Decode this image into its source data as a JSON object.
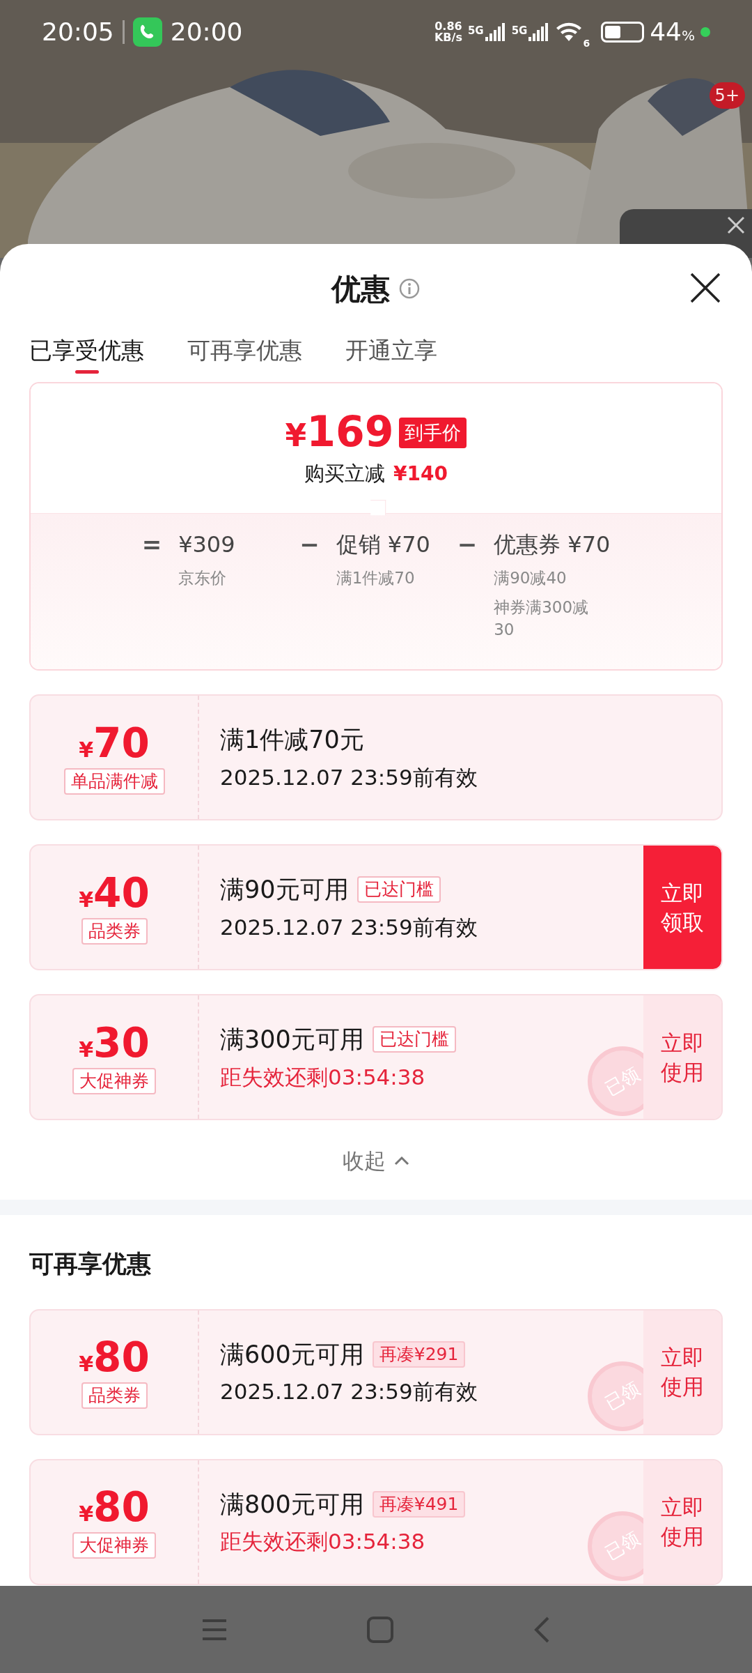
{
  "status_bar": {
    "time": "20:05",
    "call_time": "20:00",
    "speed": "0.86\nKB/s",
    "networks": [
      "5G",
      "5G"
    ],
    "wifi_label": "6",
    "battery": "44",
    "battery_unit": "%"
  },
  "background": {
    "kind": "picture",
    "badge": "5+"
  },
  "sheet": {
    "title": "优惠",
    "tabs": [
      {
        "label": "已享受优惠",
        "selected": true
      },
      {
        "label": "可再享优惠",
        "selected": false
      },
      {
        "label": "开通立享",
        "selected": false
      }
    ],
    "summary": {
      "price_symbol": "¥",
      "price": "169",
      "price_badge": "到手价",
      "saving_label": "购买立减",
      "saving": "¥140",
      "formula": [
        {
          "kind": "op",
          "text": "="
        },
        {
          "kind": "term",
          "text": "¥309",
          "notes": [
            "京东价"
          ]
        },
        {
          "kind": "op",
          "text": "−"
        },
        {
          "kind": "term",
          "text": "促销 ¥70",
          "notes": [
            "满1件减70"
          ]
        },
        {
          "kind": "op",
          "text": "−"
        },
        {
          "kind": "term",
          "text": "优惠券 ¥70",
          "notes": [
            "满90减40",
            "神券满300减30"
          ]
        }
      ]
    },
    "coupons": [
      {
        "symbol": "¥",
        "amount": "70",
        "type": "单品满件减",
        "title": "满1件减70元",
        "line": {
          "kind": "date",
          "text": "2025.12.07 23:59前有效"
        }
      },
      {
        "symbol": "¥",
        "amount": "40",
        "type": "品类券",
        "title": "满90元可用",
        "tag": {
          "kind": "outline",
          "text": "已达门槛"
        },
        "line": {
          "kind": "date",
          "text": "2025.12.07 23:59前有效"
        },
        "button": {
          "kind": "solid",
          "lines": [
            "立即",
            "领取"
          ]
        }
      },
      {
        "symbol": "¥",
        "amount": "30",
        "type": "大促神券",
        "title": "满300元可用",
        "tag": {
          "kind": "outline",
          "text": "已达门槛"
        },
        "line": {
          "kind": "countdown",
          "text": "距失效还剩03:54:38"
        },
        "button": {
          "kind": "light",
          "lines": [
            "立即",
            "使用"
          ]
        },
        "stamp": "已领"
      }
    ],
    "collapse": "收起",
    "more_title": "可再享优惠",
    "more_coupons": [
      {
        "symbol": "¥",
        "amount": "80",
        "type": "品类券",
        "title": "满600元可用",
        "tag": {
          "kind": "filled",
          "text": "再凑¥291"
        },
        "line": {
          "kind": "date",
          "text": "2025.12.07 23:59前有效"
        },
        "button": {
          "kind": "light",
          "lines": [
            "立即",
            "使用"
          ]
        },
        "stamp": "已领"
      },
      {
        "symbol": "¥",
        "amount": "80",
        "type": "大促神券",
        "title": "满800元可用",
        "tag": {
          "kind": "filled",
          "text": "再凑¥491"
        },
        "line": {
          "kind": "countdown",
          "text": "距失效还剩03:54:38"
        },
        "button": {
          "kind": "light",
          "lines": [
            "立即",
            "使用"
          ]
        },
        "stamp": "已领"
      }
    ]
  }
}
